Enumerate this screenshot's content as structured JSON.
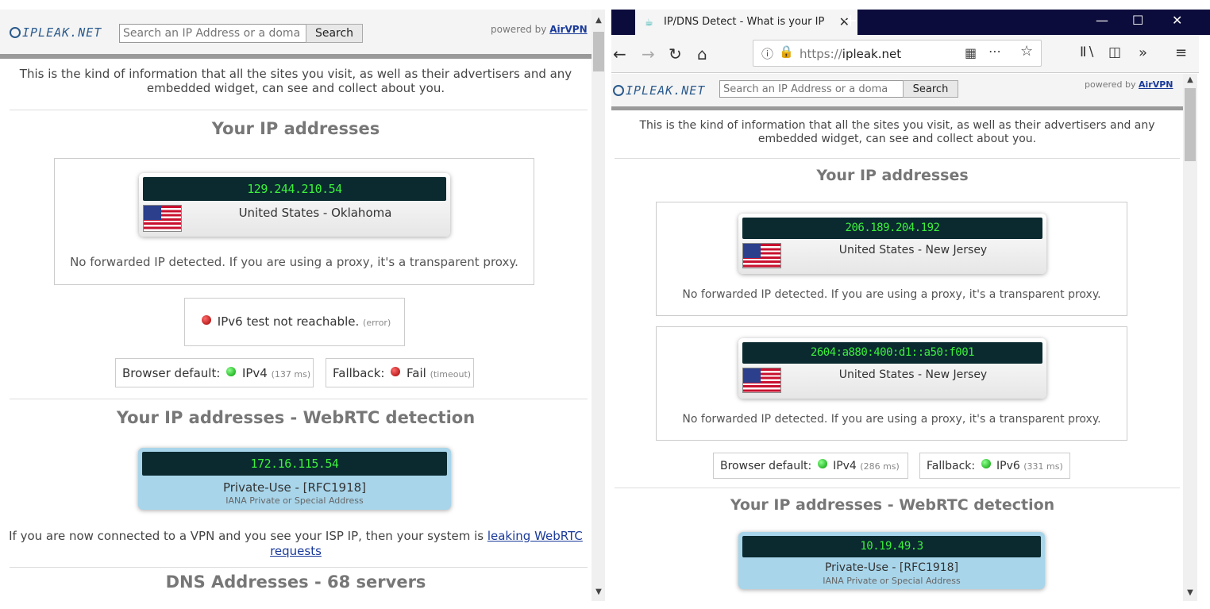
{
  "site": {
    "logo": "IPLEAK.NET",
    "search_placeholder": "Search an IP Address or a doma",
    "search_button": "Search",
    "powered_by": "powered by",
    "powered_link": "AirVPN",
    "intro": "This is the kind of information that all the sites you visit, as well as their advertisers and any embedded widget, can see and collect about you.",
    "ip_heading": "Your IP addresses",
    "webrtc_heading": "Your IP addresses - WebRTC detection",
    "forwarded_text": "No forwarded IP detected. If you are using a proxy, it's a transparent proxy.",
    "browser_default_label": "Browser default:",
    "fallback_label": "Fallback:"
  },
  "left": {
    "ip": "129.244.210.54",
    "location": "United States - Oklahoma",
    "ipv6_test": "IPv6 test not reachable.",
    "ipv6_test_note": "(error)",
    "browser_default": {
      "value": "IPv4",
      "note": "(137 ms)"
    },
    "fallback": {
      "value": "Fail",
      "note": "(timeout)"
    },
    "webrtc": {
      "ip": "172.16.115.54",
      "title": "Private-Use - [RFC1918]",
      "sub": "IANA Private or Special Address"
    },
    "leak_text": "If you are now connected to a VPN and you see your ISP IP, then your system is",
    "leak_link": "leaking WebRTC requests",
    "dns_heading": "DNS Addresses - 68 servers"
  },
  "right": {
    "tab_title": "IP/DNS Detect - What is your IP",
    "url_scheme": "https://",
    "url_host": "ipleak.net",
    "ips": [
      {
        "ip": "206.189.204.192",
        "location": "United States - New Jersey"
      },
      {
        "ip": "2604:a880:400:d1::a50:f001",
        "location": "United States - New Jersey"
      }
    ],
    "browser_default": {
      "value": "IPv4",
      "note": "(286 ms)"
    },
    "fallback": {
      "value": "IPv6",
      "note": "(331 ms)"
    },
    "webrtc": {
      "ip": "10.19.49.3",
      "title": "Private-Use - [RFC1918]",
      "sub": "IANA Private or Special Address"
    }
  }
}
